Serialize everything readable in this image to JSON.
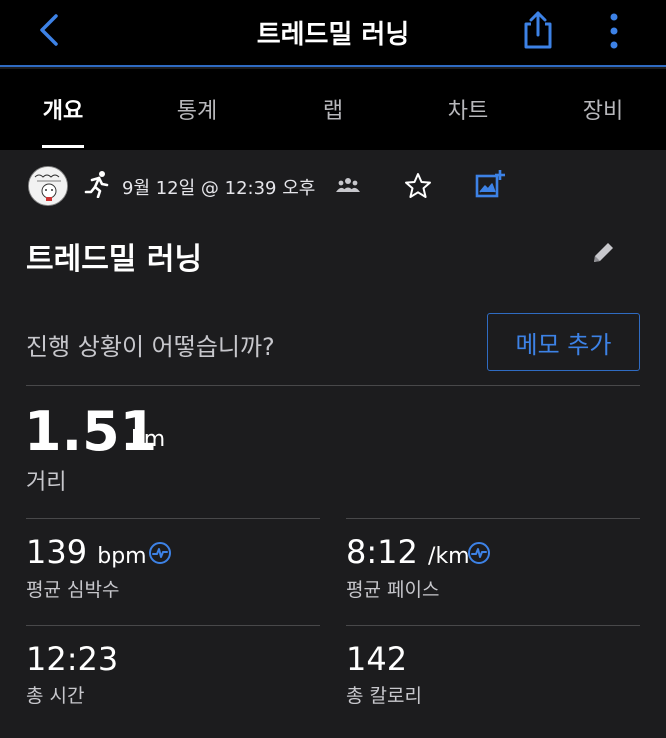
{
  "header": {
    "title": "트레드밀 러닝",
    "back_icon": "chevron-left-icon",
    "share_icon": "share-icon",
    "more_icon": "more-vertical-icon"
  },
  "tabs": [
    {
      "label": "개요",
      "active": true
    },
    {
      "label": "통계",
      "active": false
    },
    {
      "label": "랩",
      "active": false
    },
    {
      "label": "차트",
      "active": false
    },
    {
      "label": "장비",
      "active": false
    }
  ],
  "meta": {
    "date": "9월 12일 @ 12:39 오후"
  },
  "activity": {
    "name": "트레드밀 러닝"
  },
  "note": {
    "prompt": "진행 상황이 어떻습니까?",
    "button": "메모 추가"
  },
  "distance": {
    "value": "1.51",
    "unit": "km",
    "label": "거리"
  },
  "stats": {
    "avg_hr": {
      "value": "139",
      "unit": "bpm",
      "label": "평균 심박수"
    },
    "avg_pace": {
      "value": "8:12",
      "unit": "/km",
      "label": "평균 페이스"
    },
    "total_time": {
      "value": "12:23",
      "label": "총 시간"
    },
    "calories": {
      "value": "142",
      "label": "총 칼로리"
    }
  },
  "colors": {
    "accent": "#2f6bc2",
    "background": "#1c1c1e",
    "header": "#000000"
  }
}
